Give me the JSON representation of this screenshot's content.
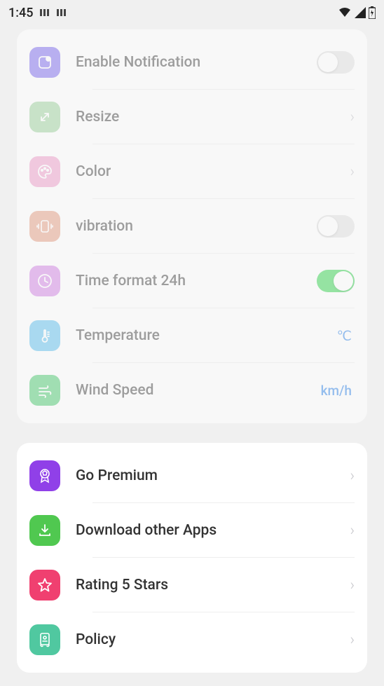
{
  "statusbar": {
    "time": "1:45"
  },
  "section1": {
    "items": [
      {
        "label": "Enable Notification",
        "toggle": false
      },
      {
        "label": "Resize"
      },
      {
        "label": "Color"
      },
      {
        "label": "vibration",
        "toggle": false
      },
      {
        "label": "Time format 24h",
        "toggle": true
      },
      {
        "label": "Temperature",
        "value": "℃"
      },
      {
        "label": "Wind Speed",
        "value": "km/h"
      }
    ]
  },
  "section2": {
    "items": [
      {
        "label": "Go Premium"
      },
      {
        "label": "Download other Apps"
      },
      {
        "label": "Rating 5 Stars"
      },
      {
        "label": "Policy"
      }
    ]
  }
}
